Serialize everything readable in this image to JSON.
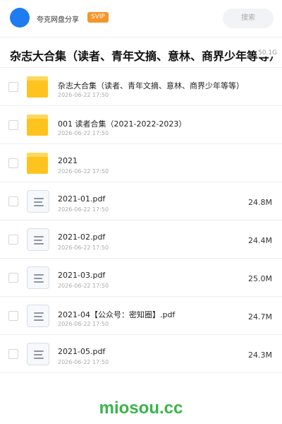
{
  "header": {
    "user_name": "夸克网盘分享",
    "badge": "SVIP",
    "search_placeholder": "搜索"
  },
  "share": {
    "title": "杂志大合集（读者、青年文摘、意林、商界少年等等）",
    "total_size": "50.1G"
  },
  "items": [
    {
      "type": "folder",
      "name": "杂志大合集（读者、青年文摘、意林、商界少年等等）",
      "date": "2026-06-22 17:50",
      "size": ""
    },
    {
      "type": "folder",
      "name": "001 读者合集（2021-2022-2023）",
      "date": "2026-06-22 17:50",
      "size": ""
    },
    {
      "type": "folder",
      "name": "2021",
      "date": "2026-06-22 17:50",
      "size": ""
    },
    {
      "type": "file",
      "name": "2021-01.pdf",
      "date": "2026-06-22 17:50",
      "size": "24.8M"
    },
    {
      "type": "file",
      "name": "2021-02.pdf",
      "date": "2026-06-22 17:50",
      "size": "24.4M"
    },
    {
      "type": "file",
      "name": "2021-03.pdf",
      "date": "2026-06-22 17:50",
      "size": "25.0M"
    },
    {
      "type": "file",
      "name": "2021-04【公众号：密知圈】.pdf",
      "date": "2026-06-22 17:50",
      "size": "24.7M"
    },
    {
      "type": "file",
      "name": "2021-05.pdf",
      "date": "2026-06-22 17:50",
      "size": "24.3M"
    }
  ],
  "watermark": "miosou.cc",
  "colors": {
    "avatar": "#1e7cf0",
    "badge": "#f5962b",
    "folder": "#ffc31f",
    "watermark": "#38b54a"
  },
  "icons": {
    "folder": "folder-icon",
    "file": "pdf-file-icon"
  }
}
